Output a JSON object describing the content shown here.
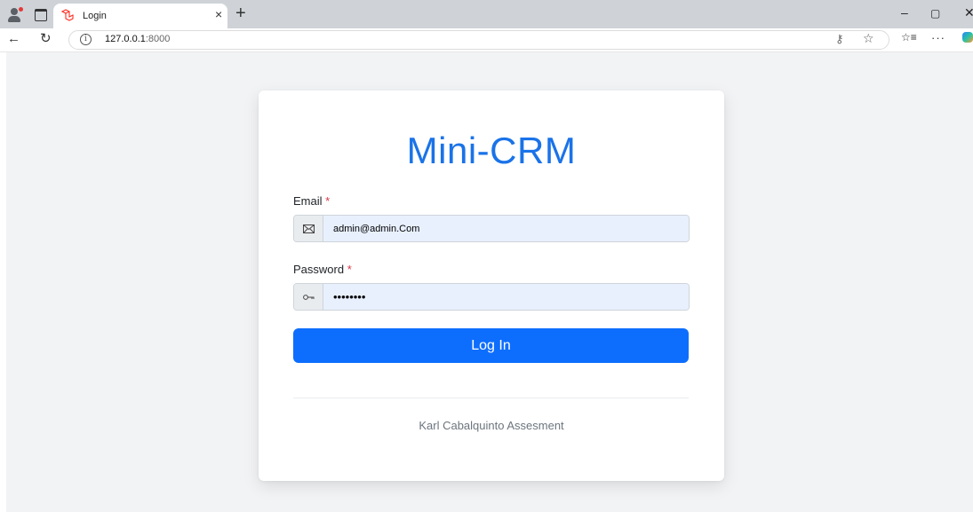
{
  "browser": {
    "tab_title": "Login",
    "tab_close": "×",
    "new_tab": "+",
    "url_host": "127.0.0.1",
    "url_port": ":8000",
    "icons": [
      "profile-icon",
      "tabs-icon",
      "laravel-icon",
      "back-icon",
      "refresh-icon",
      "info-icon",
      "key-icon",
      "star-icon",
      "favorites-icon",
      "more-icon",
      "copilot-icon"
    ],
    "window": {
      "minimize": "–",
      "restore": "▢",
      "close": "✕"
    }
  },
  "login": {
    "brand": "Mini-CRM",
    "email_label": "Email",
    "email_value": "admin@admin.Com",
    "password_label": "Password",
    "password_value": "••••••••",
    "required_mark": "*",
    "button_label": "Log In",
    "footer": "Karl Cabalquinto Assesment"
  },
  "colors": {
    "brand": "#1a73e8",
    "primary_button": "#0d6efd",
    "autofill_bg": "#e8f0fe",
    "required": "#dc3545",
    "page_bg": "#f2f3f5"
  }
}
